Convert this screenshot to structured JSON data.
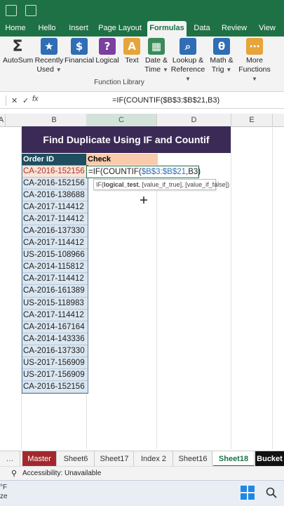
{
  "ribbon_tabs": [
    "Home",
    "Hello",
    "Insert",
    "Page Layout",
    "Formulas",
    "Data",
    "Review",
    "View"
  ],
  "active_tab": "Formulas",
  "ribbon_buttons": [
    {
      "line1": "AutoSum",
      "line2": "",
      "icon": "sigma-icon",
      "glyph": "Σ"
    },
    {
      "line1": "Recently",
      "line2": "Used",
      "icon": "star-icon",
      "glyph": "★"
    },
    {
      "line1": "Financial",
      "line2": "",
      "icon": "financial-icon",
      "glyph": "$"
    },
    {
      "line1": "Logical",
      "line2": "",
      "icon": "logical-icon",
      "glyph": "?"
    },
    {
      "line1": "Text",
      "line2": "",
      "icon": "text-icon",
      "glyph": "A"
    },
    {
      "line1": "Date &",
      "line2": "Time",
      "icon": "calendar-icon",
      "glyph": "▦"
    },
    {
      "line1": "Lookup &",
      "line2": "Reference",
      "icon": "lookup-icon",
      "glyph": "⌕"
    },
    {
      "line1": "Math &",
      "line2": "Trig",
      "icon": "math-icon",
      "glyph": "θ"
    },
    {
      "line1": "More",
      "line2": "Functions",
      "icon": "more-functions-icon",
      "glyph": "⋯"
    }
  ],
  "ribbon_group_label": "Function Library",
  "formula_bar": {
    "formula": "=IF(COUNTIF($B$3:$B$21,B3)"
  },
  "columns": [
    "A",
    "B",
    "C",
    "D",
    "E"
  ],
  "sheet": {
    "title": "Find Duplicate Using IF and Countif",
    "header_order": "Order ID",
    "header_check": "Check",
    "order_ids": [
      "CA-2016-152156",
      "CA-2016-152156",
      "CA-2016-138688",
      "CA-2017-114412",
      "CA-2017-114412",
      "CA-2016-137330",
      "CA-2017-114412",
      "US-2015-108966",
      "CA-2014-115812",
      "CA-2017-114412",
      "CA-2016-161389",
      "US-2015-118983",
      "CA-2017-114412",
      "CA-2014-167164",
      "CA-2014-143336",
      "CA-2016-137330",
      "US-2017-156909",
      "US-2017-156909",
      "CA-2016-152156"
    ],
    "edit_cell": {
      "eq": "=IF(COUNTIF(",
      "range": "$B$3:$B$21",
      "rest": ",B3)"
    },
    "tooltip": {
      "start": "IF(",
      "arg1": "logical_test",
      "rest": ", [value_if_true], [value_if_false])"
    }
  },
  "sheet_tabs": [
    "Master",
    "Sheet6",
    "Sheet17",
    "Index 2",
    "Sheet16",
    "Sheet18",
    "Bucket"
  ],
  "active_sheet": "Sheet18",
  "status": {
    "accessibility": "Accessibility: Unavailable"
  },
  "taskbar": {
    "weather_temp": "°F",
    "weather_desc": "ze"
  },
  "colors": {
    "excel_green": "#1e7145",
    "title_banner": "#3c2a56",
    "order_header": "#1f4e5f",
    "check_header": "#f8cbad",
    "master_tab": "#a3282d"
  }
}
